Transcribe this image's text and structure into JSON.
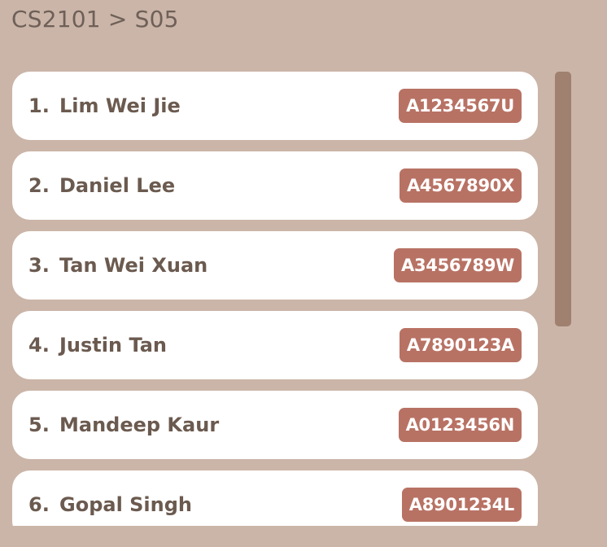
{
  "breadcrumb": "CS2101 > S05",
  "students": [
    {
      "index": "1.",
      "name": "Lim Wei Jie",
      "id": "A1234567U"
    },
    {
      "index": "2.",
      "name": "Daniel Lee",
      "id": "A4567890X"
    },
    {
      "index": "3.",
      "name": "Tan Wei Xuan",
      "id": "A3456789W"
    },
    {
      "index": "4.",
      "name": "Justin Tan",
      "id": "A7890123A"
    },
    {
      "index": "5.",
      "name": "Mandeep Kaur",
      "id": "A0123456N"
    },
    {
      "index": "6.",
      "name": "Gopal Singh",
      "id": "A8901234L"
    }
  ],
  "colors": {
    "background": "#cbb5a8",
    "card": "#ffffff",
    "text": "#6b5a4f",
    "badge": "#b87264",
    "scrollbar": "#a08170"
  }
}
